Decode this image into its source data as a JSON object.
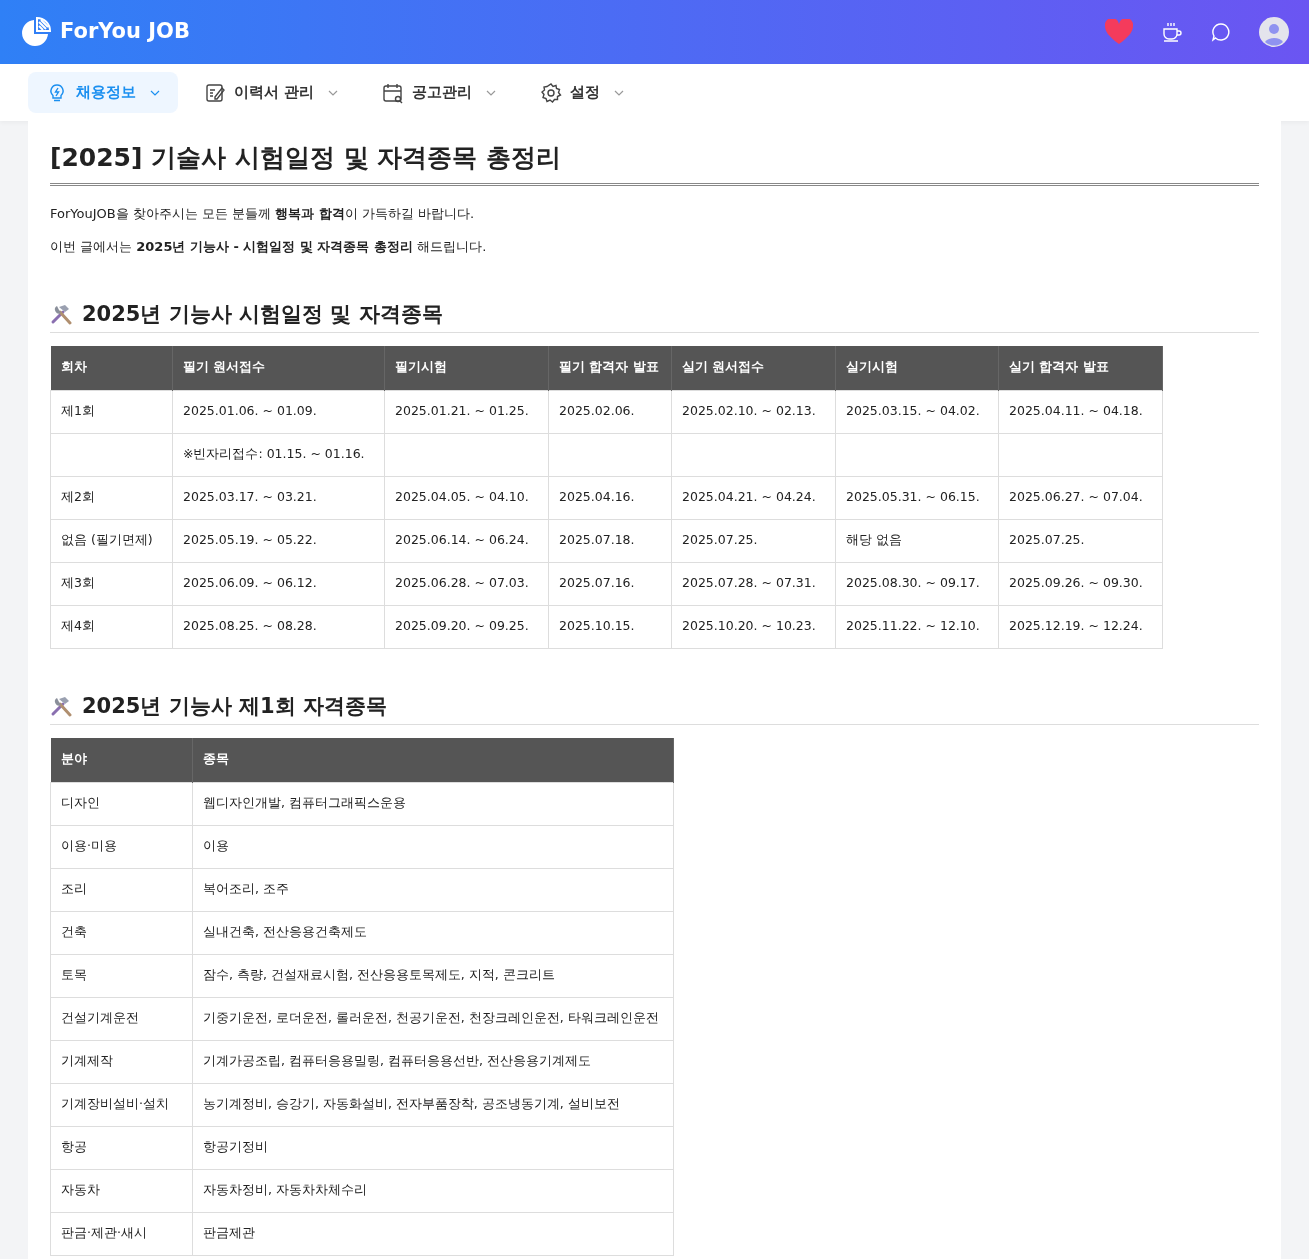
{
  "header": {
    "logo_text": "ForYou JOB"
  },
  "nav": [
    {
      "label": "채용정보",
      "selected": true
    },
    {
      "label": "이력서 관리",
      "selected": false
    },
    {
      "label": "공고관리",
      "selected": false
    },
    {
      "label": "설정",
      "selected": false
    }
  ],
  "article": {
    "title": "[2025] 기술사 시험일정 및 자격종목 총정리",
    "paragraphs": [
      "ForYouJOB을 찾아주시는 모든 분들께 **행복과 합격**이 가득하길 바랍니다.",
      "이번 글에서는 **2025년 기능사 - 시험일정 및 자격종목 총정리** 해드립니다."
    ],
    "sections": [
      {
        "heading": "2025년 기능사 시험일정 및 자격종목",
        "table": {
          "kind": "schedule",
          "columns": [
            "회차",
            "필기 원서접수",
            "필기시험",
            "필기 합격자 발표",
            "실기 원서접수",
            "실기시험",
            "실기 합격자 발표"
          ],
          "rows": [
            [
              "제1회",
              "2025.01.06. ~ 01.09.",
              "2025.01.21. ~ 01.25.",
              "2025.02.06.",
              "2025.02.10. ~ 02.13.",
              "2025.03.15. ~ 04.02.",
              "2025.04.11. ~ 04.18."
            ],
            [
              "",
              "※빈자리접수: 01.15. ~ 01.16.",
              "",
              "",
              "",
              "",
              ""
            ],
            [
              "제2회",
              "2025.03.17. ~ 03.21.",
              "2025.04.05. ~ 04.10.",
              "2025.04.16.",
              "2025.04.21. ~ 04.24.",
              "2025.05.31. ~ 06.15.",
              "2025.06.27. ~ 07.04."
            ],
            [
              "없음 (필기면제)",
              "2025.05.19. ~ 05.22.",
              "2025.06.14. ~ 06.24.",
              "2025.07.18.",
              "2025.07.25.",
              "해당 없음",
              "2025.07.25."
            ],
            [
              "제3회",
              "2025.06.09. ~ 06.12.",
              "2025.06.28. ~ 07.03.",
              "2025.07.16.",
              "2025.07.28. ~ 07.31.",
              "2025.08.30. ~ 09.17.",
              "2025.09.26. ~ 09.30."
            ],
            [
              "제4회",
              "2025.08.25. ~ 08.28.",
              "2025.09.20. ~ 09.25.",
              "2025.10.15.",
              "2025.10.20. ~ 10.23.",
              "2025.11.22. ~ 12.10.",
              "2025.12.19. ~ 12.24."
            ]
          ]
        }
      },
      {
        "heading": "2025년 기능사 제1회 자격종목",
        "table": {
          "kind": "fields",
          "columns": [
            "분야",
            "종목"
          ],
          "rows": [
            [
              "디자인",
              "웹디자인개발, 컴퓨터그래픽스운용"
            ],
            [
              "이용·미용",
              "이용"
            ],
            [
              "조리",
              "복어조리, 조주"
            ],
            [
              "건축",
              "실내건축, 전산응용건축제도"
            ],
            [
              "토목",
              "잠수, 측량, 건설재료시험, 전산응용토목제도, 지적, 콘크리트"
            ],
            [
              "건설기계운전",
              "기중기운전, 로더운전, 롤러운전, 천공기운전, 천장크레인운전, 타워크레인운전"
            ],
            [
              "기계제작",
              "기계가공조립, 컴퓨터응용밀링, 컴퓨터응용선반, 전산응용기계제도"
            ],
            [
              "기계장비설비·설치",
              "농기계정비, 승강기, 자동화설비, 전자부품장착, 공조냉동기계, 설비보전"
            ],
            [
              "항공",
              "항공기정비"
            ],
            [
              "자동차",
              "자동차정비, 자동차차체수리"
            ],
            [
              "판금·제관·새시",
              "판금제관"
            ]
          ]
        }
      }
    ]
  }
}
